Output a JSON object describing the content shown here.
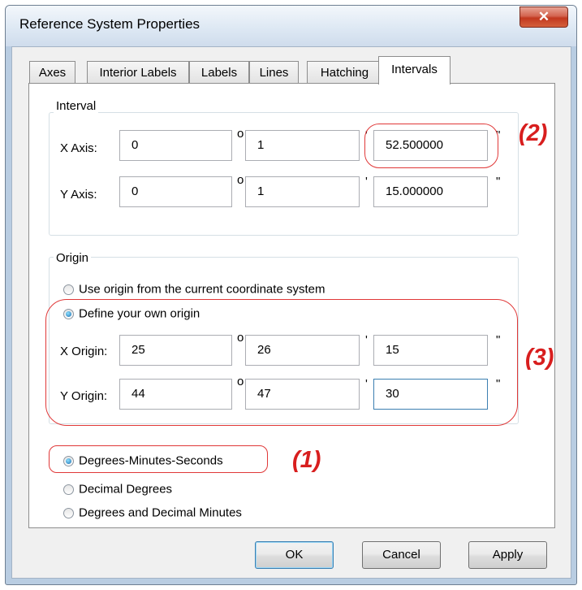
{
  "window": {
    "title": "Reference System Properties",
    "close_glyph": "✕"
  },
  "tabs": [
    {
      "label": "Axes"
    },
    {
      "label": "Interior Labels"
    },
    {
      "label": "Labels"
    },
    {
      "label": "Lines"
    },
    {
      "label": "Hatching"
    },
    {
      "label": "Intervals"
    }
  ],
  "active_tab": "Intervals",
  "interval": {
    "group_label": "Interval",
    "x": {
      "label": "X Axis:",
      "deg": "0",
      "min": "1",
      "sec": "52.500000"
    },
    "y": {
      "label": "Y Axis:",
      "deg": "0",
      "min": "1",
      "sec": "15.000000"
    }
  },
  "origin": {
    "group_label": "Origin",
    "use_current": "Use origin from the current coordinate system",
    "define_own": "Define your own origin",
    "selected": "define_own",
    "x": {
      "label": "X Origin:",
      "deg": "25",
      "min": "26",
      "sec": "15"
    },
    "y": {
      "label": "Y Origin:",
      "deg": "44",
      "min": "47",
      "sec": "30"
    }
  },
  "symbols": {
    "degree": "o",
    "minute": "'",
    "second": "\""
  },
  "format_options": [
    {
      "label": "Degrees-Minutes-Seconds",
      "checked": true
    },
    {
      "label": "Decimal Degrees",
      "checked": false
    },
    {
      "label": "Degrees and Decimal Minutes",
      "checked": false
    }
  ],
  "annotations": {
    "a1": "(1)",
    "a2": "(2)",
    "a3": "(3)"
  },
  "buttons": {
    "ok": "OK",
    "cancel": "Cancel",
    "apply": "Apply"
  },
  "colors": {
    "annotation": "#d81e1e",
    "focus_border": "#3c7fb1"
  }
}
